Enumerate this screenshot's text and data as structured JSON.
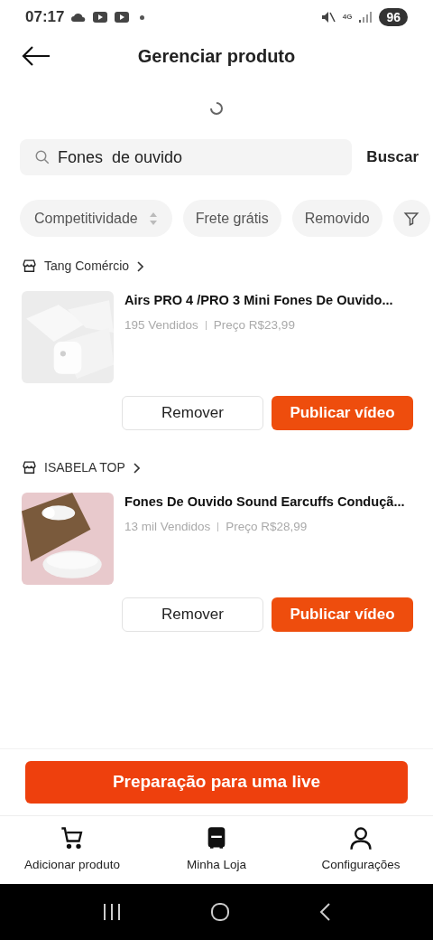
{
  "status_bar": {
    "time": "07:17",
    "network": "4G",
    "battery": "96"
  },
  "header": {
    "title": "Gerenciar produto"
  },
  "search": {
    "value": "Fones  de ouvido",
    "button": "Buscar"
  },
  "filters": [
    {
      "kind": "sort",
      "label": "Competitividade"
    },
    {
      "kind": "chip",
      "label": "Frete grátis"
    },
    {
      "kind": "chip",
      "label": "Removido"
    },
    {
      "kind": "icon"
    }
  ],
  "products": [
    {
      "shop": "Tang Comércio",
      "title": "Airs PRO 4 /PRO 3 Mini Fones De Ouvido...",
      "sold": "195 Vendidos",
      "price": "Preço R$23,99",
      "actions": [
        "Remover",
        "Publicar vídeo"
      ]
    },
    {
      "shop": "ISABELA TOP",
      "title": "Fones De Ouvido Sound Earcuffs Conduçã...",
      "sold": "13 mil Vendidos",
      "price": "Preço R$28,99",
      "actions": [
        "Remover",
        "Publicar vídeo"
      ]
    }
  ],
  "live_button": "Preparação para uma live",
  "nav": [
    {
      "kind": "cart",
      "label": "Adicionar produto"
    },
    {
      "kind": "store",
      "label": "Minha Loja"
    },
    {
      "kind": "person",
      "label": "Configurações"
    }
  ]
}
